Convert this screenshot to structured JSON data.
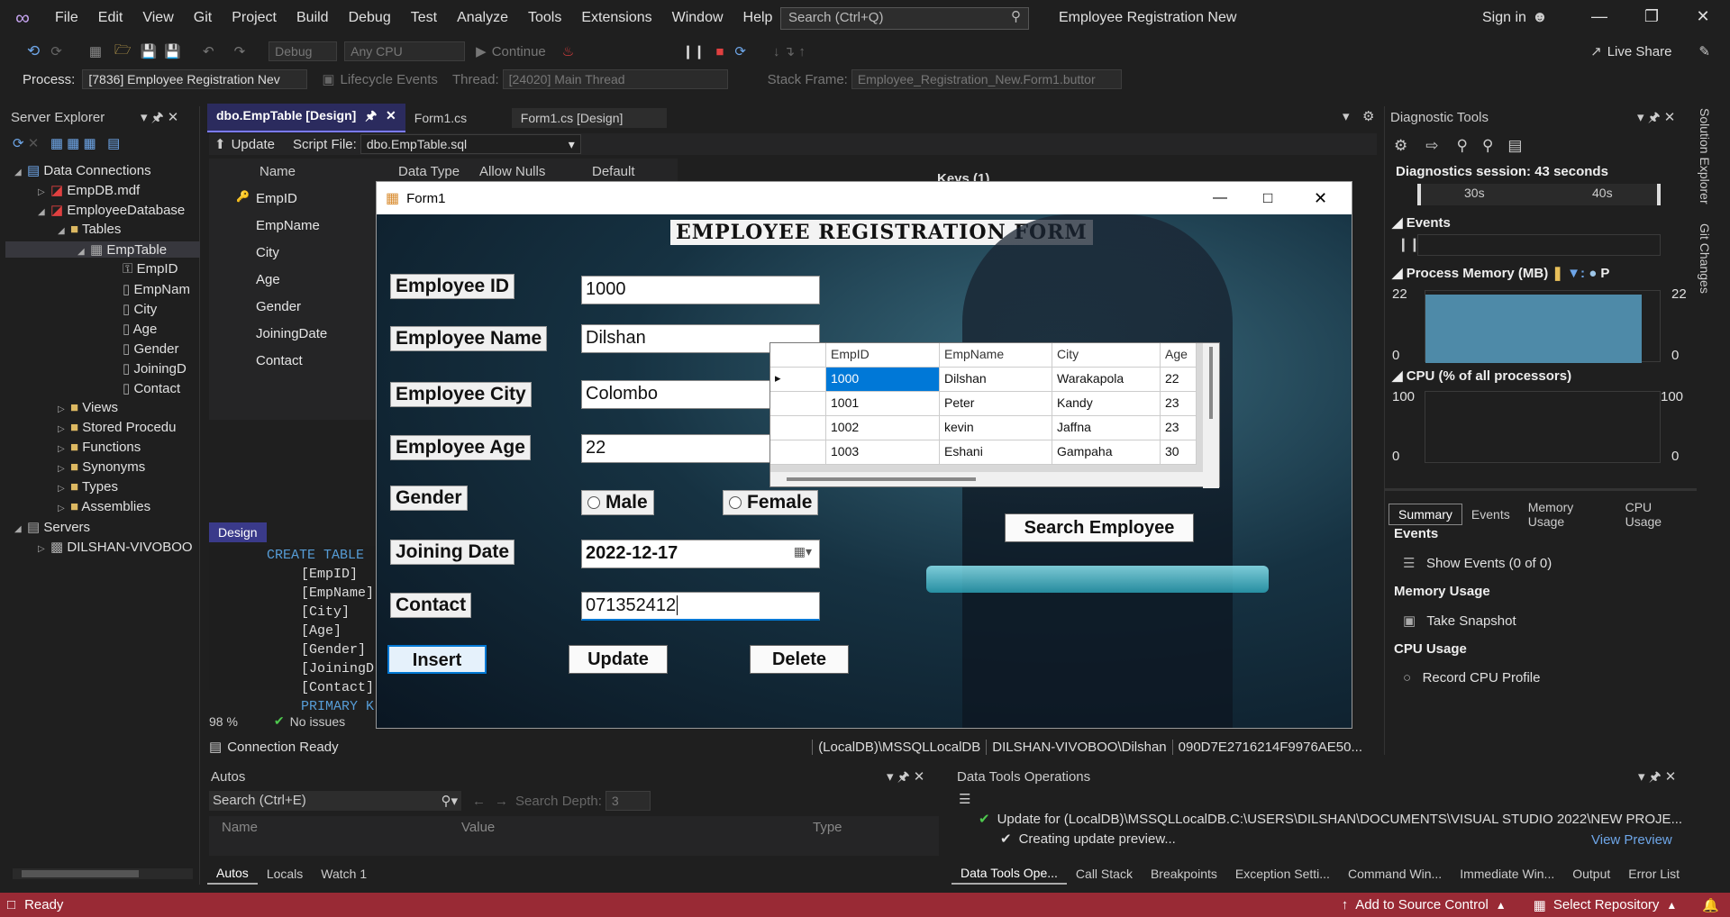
{
  "menu": {
    "items": [
      "File",
      "Edit",
      "View",
      "Git",
      "Project",
      "Build",
      "Debug",
      "Test",
      "Analyze",
      "Tools",
      "Extensions",
      "Window",
      "Help"
    ],
    "search_placeholder": "Search (Ctrl+Q)",
    "app_title": "Employee Registration New",
    "sign_in": "Sign in"
  },
  "toolbar": {
    "config": "Debug",
    "platform": "Any CPU",
    "continue": "Continue",
    "live_share": "Live Share"
  },
  "processbar": {
    "process_label": "Process:",
    "process_value": "[7836] Employee Registration Nev",
    "lifecycle": "Lifecycle Events",
    "thread_label": "Thread:",
    "thread_value": "[24020] Main Thread",
    "stack_label": "Stack Frame:",
    "stack_value": "Employee_Registration_New.Form1.buttor"
  },
  "server_explorer": {
    "title": "Server Explorer",
    "data_connections": "Data Connections",
    "empdb": "EmpDB.mdf",
    "employeedb": "EmployeeDatabase",
    "tables": "Tables",
    "emptable": "EmpTable",
    "columns": [
      "EmpID",
      "EmpNam",
      "City",
      "Age",
      "Gender",
      "JoiningD",
      "Contact"
    ],
    "views": "Views",
    "stored": "Stored Procedu",
    "functions": "Functions",
    "synonyms": "Synonyms",
    "types": "Types",
    "assemblies": "Assemblies",
    "servers": "Servers",
    "server_name": "DILSHAN-VIVOBOO"
  },
  "editor": {
    "tabs": [
      "dbo.EmpTable [Design]",
      "Form1.cs",
      "Form1.cs [Design]"
    ],
    "update": "Update",
    "script_file_label": "Script File:",
    "script_file": "dbo.EmpTable.sql",
    "col_name": "Name",
    "col_type": "Data Type",
    "col_nulls": "Allow Nulls",
    "col_default": "Default",
    "keys": "Keys (1)",
    "rows": [
      "EmpID",
      "EmpName",
      "City",
      "Age",
      "Gender",
      "JoiningDate",
      "Contact"
    ],
    "design_tab": "Design",
    "sql_lines": [
      "CREATE TABLE",
      "[EmpID]",
      "[EmpName]",
      "[City]",
      "[Age]",
      "[Gender]",
      "[JoiningD",
      "[Contact]",
      "PRIMARY K"
    ],
    "zoom": "98 %",
    "no_issues": "No issues",
    "connection_ready": "Connection Ready",
    "conn_info": "(LocalDB)\\MSSQLLocalDB",
    "user_info": "DILSHAN-VIVOBOO\\Dilshan",
    "guid": "090D7E2716214F9976AE50..."
  },
  "form": {
    "title": "Form1",
    "heading": "EMPLOYEE REGISTRATION FORM",
    "labels": {
      "emp_id": "Employee ID",
      "emp_name": "Employee Name",
      "emp_city": "Employee City",
      "emp_age": "Employee Age",
      "gender": "Gender",
      "joining": "Joining Date",
      "contact": "Contact"
    },
    "values": {
      "emp_id": "1000",
      "emp_name": "Dilshan",
      "emp_city": "Colombo",
      "emp_age": "22",
      "joining": "2022-12-17",
      "contact": "071352412"
    },
    "male": "Male",
    "female": "Female",
    "insert": "Insert",
    "update": "Update",
    "delete": "Delete",
    "search": "Search Employee",
    "grid": {
      "headers": [
        "EmpID",
        "EmpName",
        "City",
        "Age"
      ],
      "rows": [
        [
          "1000",
          "Dilshan",
          "Warakapola",
          "22"
        ],
        [
          "1001",
          "Peter",
          "Kandy",
          "23"
        ],
        [
          "1002",
          "kevin",
          "Jaffna",
          "23"
        ],
        [
          "1003",
          "Eshani",
          "Gampaha",
          "30"
        ]
      ]
    }
  },
  "diag": {
    "title": "Diagnostic Tools",
    "session": "Diagnostics session: 43 seconds",
    "t30": "30s",
    "t40": "40s",
    "events": "Events",
    "process_memory": "Process Memory (MB)",
    "mem_max": "22",
    "mem_min": "0",
    "cpu": "CPU (% of all processors)",
    "cpu_max": "100",
    "cpu_min": "0",
    "tabs": [
      "Summary",
      "Events",
      "Memory Usage",
      "CPU Usage"
    ],
    "events_h": "Events",
    "show_events": "Show Events (0 of 0)",
    "memory_h": "Memory Usage",
    "take_snapshot": "Take Snapshot",
    "cpu_h": "CPU Usage",
    "record_cpu": "Record CPU Profile",
    "side_tabs": [
      "Solution Explorer",
      "Git Changes"
    ]
  },
  "autos": {
    "title": "Autos",
    "search": "Search (Ctrl+E)",
    "depth_label": "Search Depth:",
    "depth": "3",
    "col_name": "Name",
    "col_value": "Value",
    "col_type": "Type",
    "tabs": [
      "Autos",
      "Locals",
      "Watch 1"
    ]
  },
  "dto": {
    "title": "Data Tools Operations",
    "line1": "Update for (LocalDB)\\MSSQLLocalDB.C:\\USERS\\DILSHAN\\DOCUMENTS\\VISUAL STUDIO 2022\\NEW PROJE...",
    "line2": "Creating update preview...",
    "view_preview": "View Preview",
    "tabs": [
      "Data Tools Ope...",
      "Call Stack",
      "Breakpoints",
      "Exception Setti...",
      "Command Win...",
      "Immediate Win...",
      "Output",
      "Error List"
    ]
  },
  "status": {
    "ready": "Ready",
    "add_source": "Add to Source Control",
    "select_repo": "Select Repository"
  }
}
